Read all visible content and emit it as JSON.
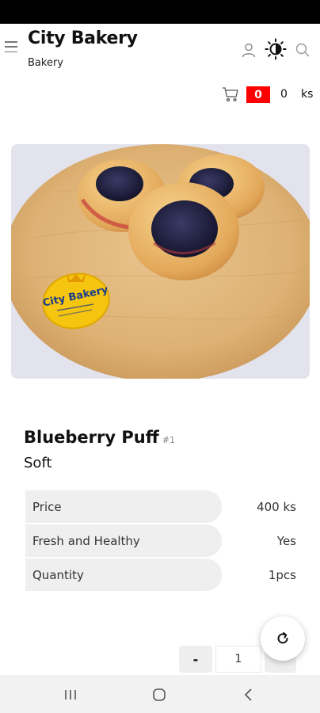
{
  "app": {
    "name": "City Bakery",
    "subtitle": "Bakery"
  },
  "header": {
    "icons": [
      "menu-icon",
      "user-icon",
      "theme-toggle-icon",
      "search-icon"
    ]
  },
  "cart": {
    "count": "0",
    "total": "0",
    "currency": "ks",
    "badge_color": "#ff0000"
  },
  "product": {
    "image_alt": "Blueberry Puff",
    "logo_text": "City Bakery",
    "name": "Blueberry Puff",
    "id_label": "#1",
    "subtitle": "Soft",
    "details": [
      {
        "label": "Price",
        "value": "400 ks"
      },
      {
        "label": "Fresh and Healthy",
        "value": "Yes"
      },
      {
        "label": "Quantity",
        "value": "1pcs"
      }
    ]
  },
  "quantity_selector": {
    "minus_label": "-",
    "value": "1"
  },
  "fab": {
    "icon": "refresh-icon"
  },
  "system_nav": {
    "icons": [
      "recent-apps-icon",
      "home-icon",
      "back-icon"
    ]
  }
}
